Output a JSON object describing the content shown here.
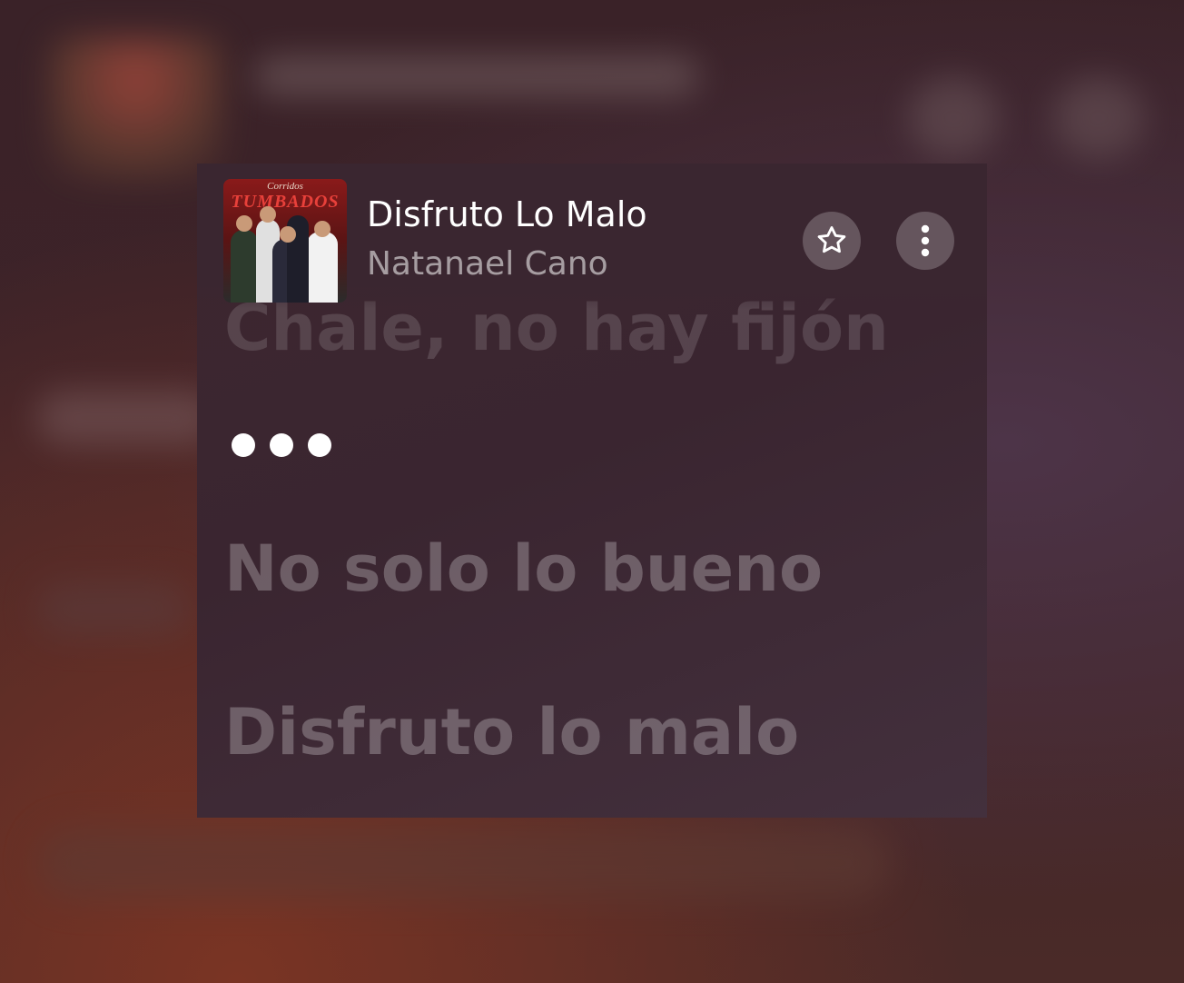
{
  "track": {
    "title": "Disfruto Lo Malo",
    "artist": "Natanael Cano",
    "album_art": {
      "top_text": "Corridos",
      "main_text": "TUMBADOS"
    }
  },
  "actions": {
    "favorite_icon": "star-outline-icon",
    "more_icon": "more-vertical-icon"
  },
  "lyrics": {
    "previous_line": "Chale, no hay fijón",
    "instrumental_indicator": "•••",
    "lines": [
      "No solo lo bueno",
      "Disfruto lo malo"
    ]
  },
  "colors": {
    "active_white": "#ffffff",
    "dim_lyric": "rgba(255,255,255,0.26)",
    "button_bg": "rgba(255,255,255,0.22)"
  }
}
